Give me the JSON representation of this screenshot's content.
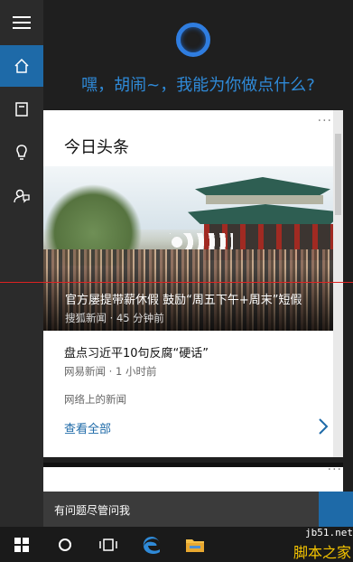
{
  "greeting": "嘿，胡闹~，我能为你做点什么?",
  "sidebar": {
    "items": [
      {
        "name": "menu-icon"
      },
      {
        "name": "home-icon"
      },
      {
        "name": "notebook-icon"
      },
      {
        "name": "lightbulb-icon"
      },
      {
        "name": "feedback-icon"
      }
    ]
  },
  "card": {
    "title": "今日头条",
    "more": "···",
    "hero_headline": "官方屡提带薪休假 鼓励“周五下午+周末”短假",
    "hero_meta": "搜狐新闻 · 45 分钟前",
    "news2_title": "盘点习近平10句反腐“硬话”",
    "news2_meta": "网易新闻 · 1 小时前",
    "web_news": "网络上的新闻",
    "see_all": "查看全部"
  },
  "card2": {
    "more": "···"
  },
  "search": {
    "placeholder": "有问题尽管问我"
  },
  "taskbar": {
    "items": [
      {
        "name": "windows-start-icon"
      },
      {
        "name": "cortana-circle-icon"
      },
      {
        "name": "task-view-icon"
      },
      {
        "name": "edge-icon"
      },
      {
        "name": "file-explorer-icon"
      }
    ]
  },
  "watermark": {
    "site": "jb51.net",
    "name": "脚本之家"
  },
  "colors": {
    "accent": "#1e6aa8",
    "cortana": "#2f7de0",
    "greeting": "#2f8ad8"
  }
}
